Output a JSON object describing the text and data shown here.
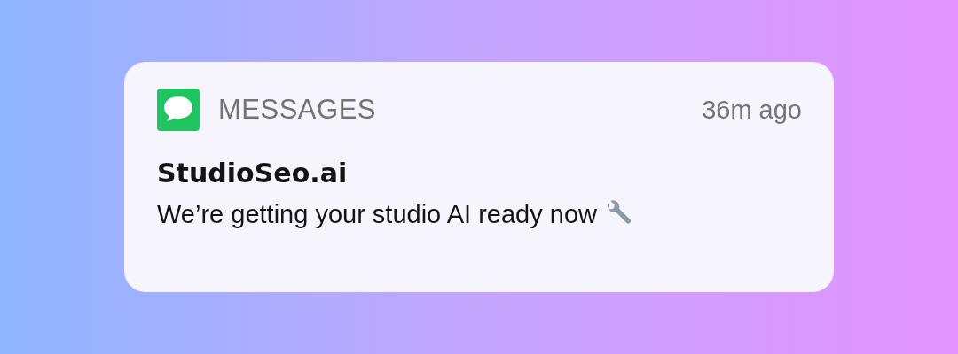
{
  "notification": {
    "app_name": "MESSAGES",
    "time": "36m ago",
    "title": "StudioSeo.ai",
    "body": "We’re getting your studio AI ready now"
  }
}
